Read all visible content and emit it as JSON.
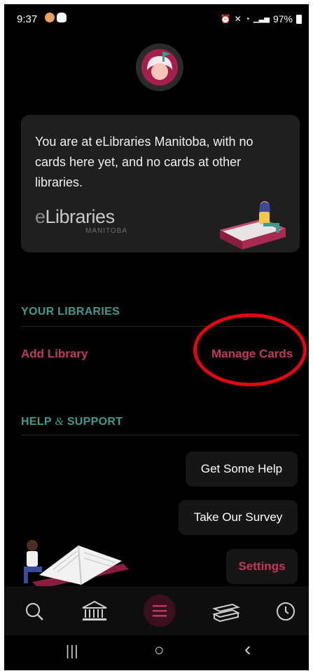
{
  "status_bar": {
    "time": "9:37",
    "battery": "97%"
  },
  "card": {
    "message": "You are at eLibraries Manitoba, with no cards here yet, and no cards at other libraries.",
    "brand_e": "e",
    "brand_rest": "Libraries",
    "brand_sub": "MANITOBA"
  },
  "your_libraries": {
    "heading": "YOUR LIBRARIES",
    "add_label": "Add Library",
    "manage_label": "Manage Cards"
  },
  "help": {
    "heading_a": "HELP ",
    "heading_amp": "&",
    "heading_b": " SUPPORT",
    "buttons": [
      "Get Some Help",
      "Take Our Survey",
      "Settings"
    ]
  },
  "nav": [
    "search-icon",
    "library-icon",
    "menu-icon",
    "books-icon",
    "clock-icon"
  ],
  "system_nav": {
    "recents": "|||",
    "home": "○",
    "back": "‹"
  },
  "colors": {
    "accent": "#c0385f",
    "teal": "#3d9a8d",
    "highlight": "#e20613"
  }
}
